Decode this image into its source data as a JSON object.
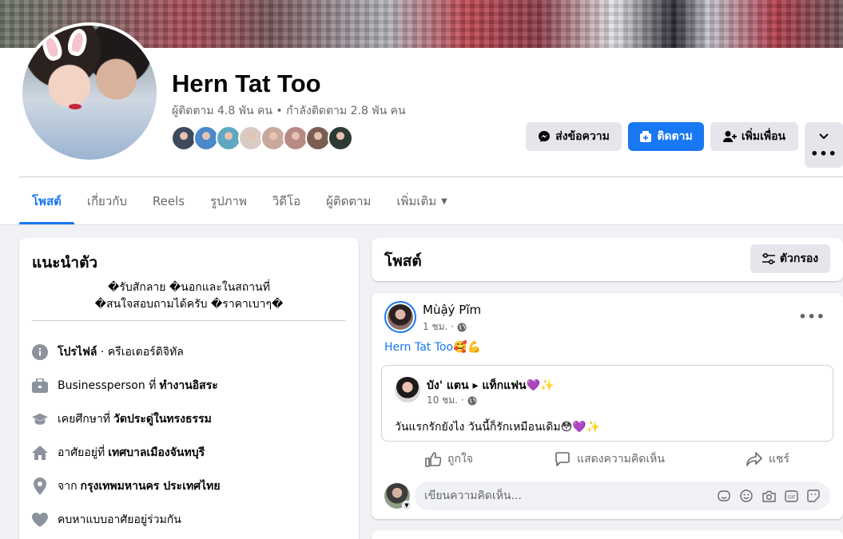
{
  "profile": {
    "name": "Hern Tat Too",
    "followers_text": "ผู้ติดตาม 4.8 พัน คน • กำลังติดตาม 2.8 พัน คน",
    "friend_colors": [
      "#3d4a5c",
      "#4a88c9",
      "#5ea8c2",
      "#d8cbc4",
      "#c9a99c",
      "#b88a84",
      "#7a5e54",
      "#2e3a34"
    ]
  },
  "buttons": {
    "message": "ส่งข้อความ",
    "follow": "ติดตาม",
    "add_friend": "เพิ่มเพื่อน"
  },
  "tabs": [
    {
      "label": "โพสต์",
      "active": true
    },
    {
      "label": "เกี่ยวกับ"
    },
    {
      "label": "Reels"
    },
    {
      "label": "รูปภาพ"
    },
    {
      "label": "วิดีโอ"
    },
    {
      "label": "ผู้ติดตาม"
    },
    {
      "label": "เพิ่มเติม"
    }
  ],
  "intro": {
    "title": "แนะนำตัว",
    "bio_line1": "�รับสักลาย �นอกและในสถานที่",
    "bio_line2": "�สนใจสอบถามได้ครับ �ราคาเบาๆ�",
    "items": [
      {
        "icon": "info-icon",
        "prefix": "โปรไฟล์",
        "text": " · ครีเอเตอร์ดิจิทัล",
        "bold": ""
      },
      {
        "icon": "briefcase-icon",
        "prefix": "",
        "text": "Businessperson ที่",
        "bold": "ทำงานอิสระ"
      },
      {
        "icon": "graduation-cap-icon",
        "prefix": "",
        "text": "เคยศึกษาที่",
        "bold": "วัดประดู่ในทรงธรรม"
      },
      {
        "icon": "home-icon",
        "prefix": "",
        "text": "อาศัยอยู่ที่",
        "bold": "เทศบาลเมืองจันทบุรี"
      },
      {
        "icon": "location-icon",
        "prefix": "",
        "text": "จาก",
        "bold": "กรุงเทพมหานคร ประเทศไทย"
      },
      {
        "icon": "heart-icon",
        "prefix": "",
        "text": "คบหาแบบอาศัยอยู่ร่วมกัน",
        "bold": ""
      }
    ]
  },
  "posts": {
    "title": "โพสต์",
    "filter_label": "ตัวกรอง"
  },
  "post": {
    "author": "Mùậý Pĩm",
    "time": "1 ชม. ·",
    "text": "Hern Tat Too🥰💪",
    "shared": {
      "author": "บัง' แตน ▸ แท็กแฟน💜✨",
      "time": "10 ชม. ·",
      "text": "วันแรกรักยังไง วันนี้ก็รักเหมือนเดิม😳💜✨"
    },
    "actions": {
      "like": "ถูกใจ",
      "comment": "แสดงความคิดเห็น",
      "share": "แชร์"
    },
    "comment_placeholder": "เขียนความคิดเห็น..."
  }
}
